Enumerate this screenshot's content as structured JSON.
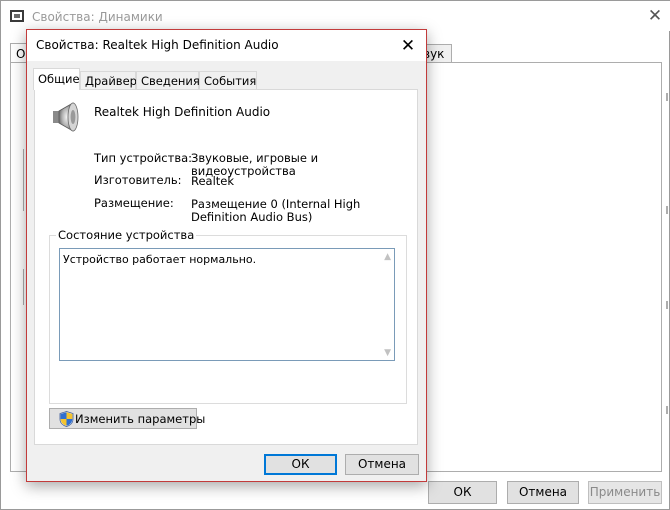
{
  "background_window": {
    "title": "Свойства: Динамики",
    "close_glyph": "✕",
    "tab_first_fragment": "Об",
    "tab_last_fragment": "вук",
    "ok_label": "ОК",
    "cancel_label": "Отмена",
    "apply_label": "Применить"
  },
  "dialog": {
    "title": "Свойства: Realtek High Definition Audio",
    "close_glyph": "✕",
    "tabs": [
      {
        "label": "Общие",
        "active": true
      },
      {
        "label": "Драйвер",
        "active": false
      },
      {
        "label": "Сведения",
        "active": false
      },
      {
        "label": "События",
        "active": false
      }
    ],
    "device_icon": "speaker-icon",
    "device_name": "Realtek High Definition Audio",
    "properties": [
      {
        "label": "Тип устройства:",
        "value": "Звуковые, игровые и видеоустройства"
      },
      {
        "label": "Изготовитель:",
        "value": "Realtek"
      },
      {
        "label": "Размещение:",
        "value": "Размещение 0 (Internal High Definition Audio Bus)"
      }
    ],
    "status_group_label": "Состояние устройства",
    "status_text": "Устройство работает нормально.",
    "change_button": {
      "icon": "uac-shield-icon",
      "label": "Изменить параметры"
    },
    "ok_label": "ОК",
    "cancel_label": "Отмена"
  },
  "colors": {
    "dialog_border": "#c23b3b",
    "focus_border": "#0078d7",
    "button_face": "#e1e1e1",
    "window_bg": "#f0f0f0"
  }
}
